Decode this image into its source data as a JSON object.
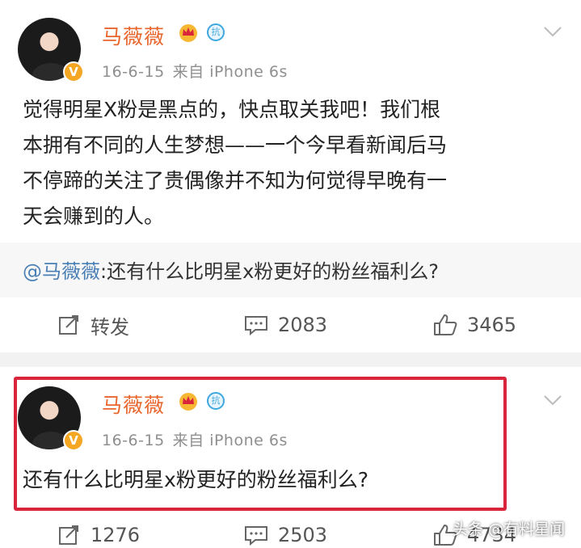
{
  "post1": {
    "username": "马薇薇",
    "date": "16-6-15",
    "source": "来自 iPhone 6s",
    "text_lines": [
      "觉得明星X粉是黑点的，快点取关我吧！我们根",
      "本拥有不同的人生梦想——一个今早看新闻后马",
      "不停蹄的关注了贵偶像并不知为何觉得早晚有一",
      "天会赚到的人。"
    ],
    "repost": {
      "mention": "@马薇薇",
      "text": ":还有什么比明星x粉更好的粉丝福利么?"
    },
    "actions": {
      "forward_label": "转发",
      "comments": "2083",
      "likes": "3465"
    }
  },
  "post2": {
    "username": "马薇薇",
    "date": "16-6-15",
    "source": "来自 iPhone 6s",
    "text": "还有什么比明星x粉更好的粉丝福利么?",
    "actions": {
      "forwards": "1276",
      "comments": "2503",
      "likes": "4734"
    }
  },
  "watermark": "头条 @有料星闻",
  "colors": {
    "username": "#e8662d",
    "mention": "#4a7fb5",
    "highlight": "#d9253b",
    "vbadge": "#f5a623"
  },
  "icons": [
    "avatar",
    "v-verified-icon",
    "crown-icon",
    "kang-badge-icon",
    "chevron-down-icon",
    "forward-icon",
    "comment-icon",
    "like-icon"
  ]
}
